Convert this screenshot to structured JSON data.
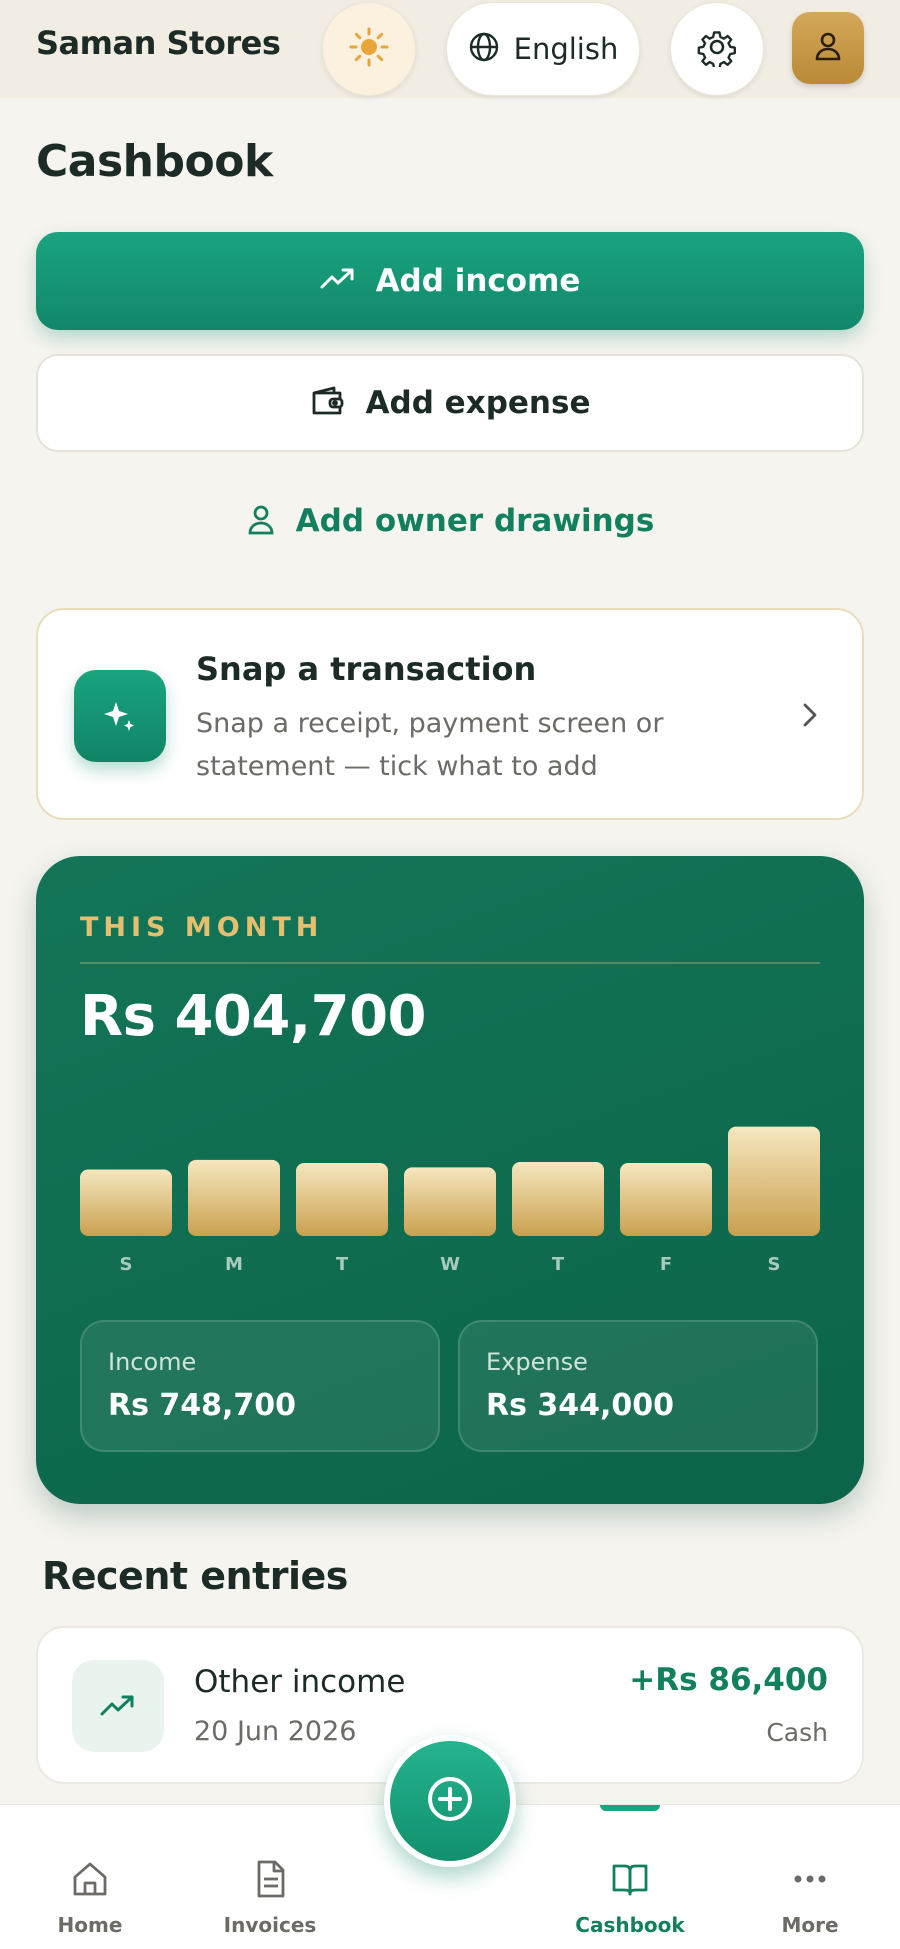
{
  "header": {
    "store_name": "Saman Stores",
    "language_label": "English",
    "theme_icon": "sun-icon",
    "settings_icon": "gear-icon",
    "profile_icon": "person-icon"
  },
  "page": {
    "title": "Cashbook"
  },
  "actions": {
    "add_income": "Add income",
    "add_expense": "Add expense",
    "add_owner_drawings": "Add owner drawings"
  },
  "snap": {
    "title": "Snap a transaction",
    "description": "Snap a receipt, payment screen or statement — tick what to add"
  },
  "month": {
    "label": "THIS MONTH",
    "total": "Rs 404,700",
    "income_label": "Income",
    "income_value": "Rs 748,700",
    "expense_label": "Expense",
    "expense_value": "Rs 344,000"
  },
  "chart_data": {
    "type": "bar",
    "categories": [
      "S",
      "M",
      "T",
      "W",
      "T",
      "F",
      "S"
    ],
    "values": [
      62,
      71,
      68,
      64,
      69,
      68,
      102
    ],
    "ylim": [
      0,
      110
    ],
    "grid": false
  },
  "recent": {
    "title": "Recent entries",
    "entries": [
      {
        "name": "Other income",
        "date": "20 Jun 2026",
        "amount": "+Rs 86,400",
        "method": "Cash"
      }
    ]
  },
  "nav": {
    "items": [
      {
        "label": "Home",
        "icon": "home-icon"
      },
      {
        "label": "Invoices",
        "icon": "document-icon"
      },
      {
        "label": "Cashbook",
        "icon": "book-icon"
      },
      {
        "label": "More",
        "icon": "more-icon"
      }
    ],
    "active": "Cashbook"
  },
  "colors": {
    "brand_green": "#12805f",
    "card_green": "#0c6449",
    "gold": "#e5bf6e"
  }
}
